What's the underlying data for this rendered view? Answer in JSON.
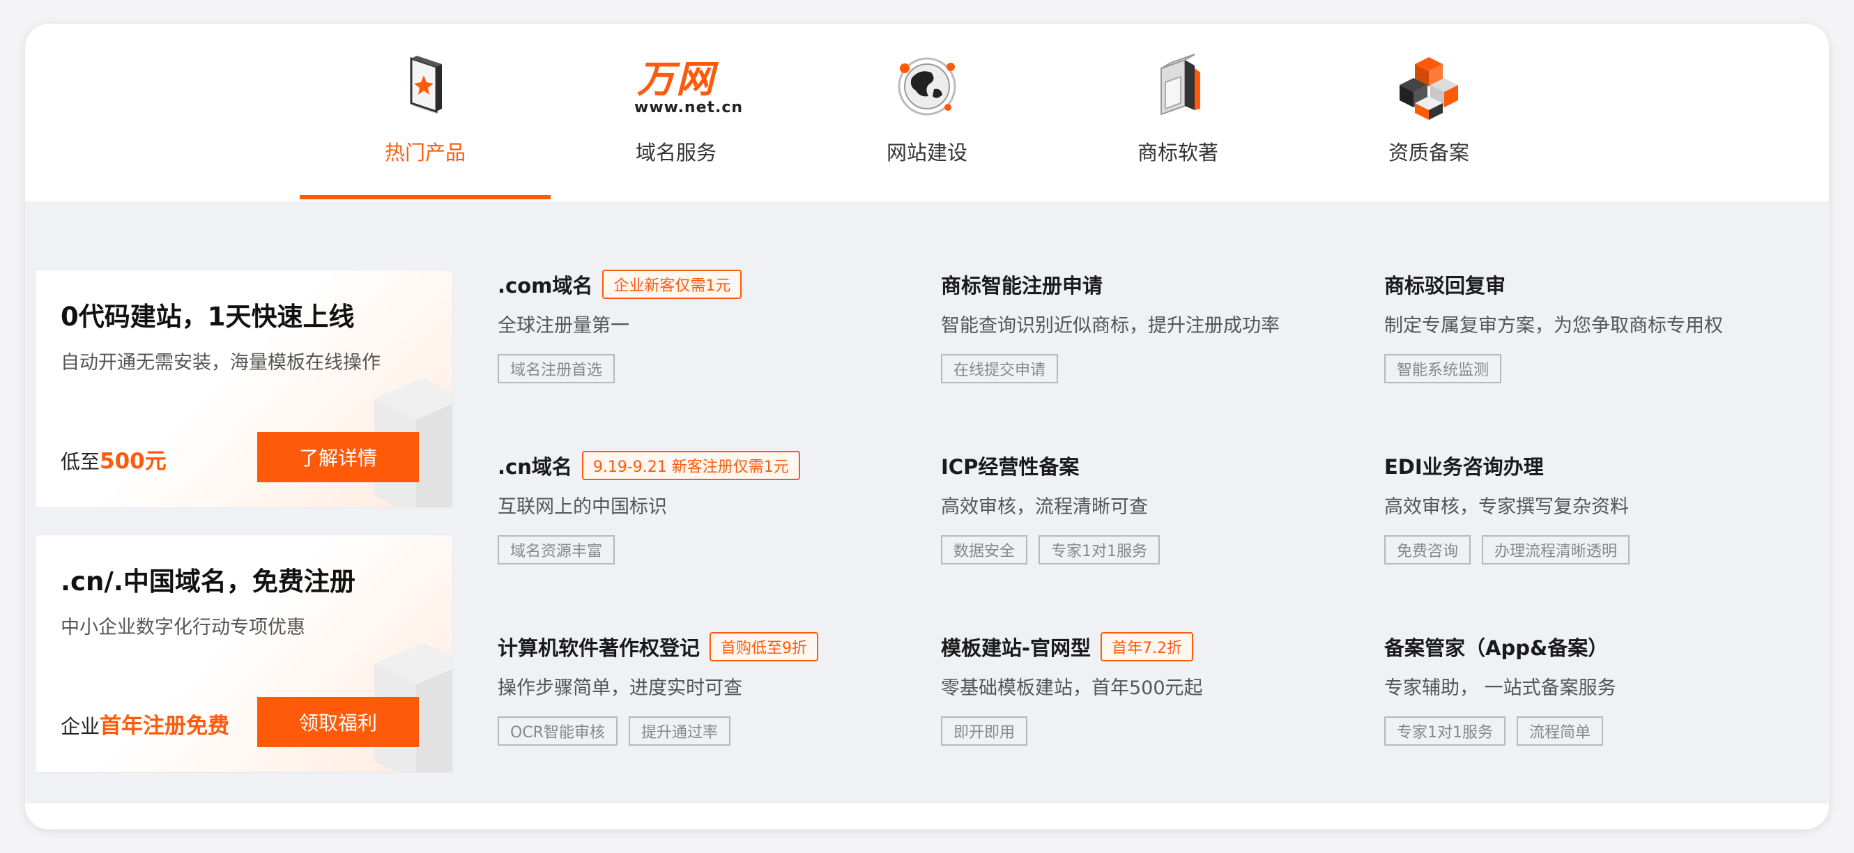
{
  "tabs": [
    {
      "label": "热门产品",
      "icon": "hot-product-icon",
      "active": true
    },
    {
      "label": "域名服务",
      "icon": "wanwang-logo",
      "logo_text": "万网",
      "logo_url": "www.net.cn",
      "active": false
    },
    {
      "label": "网站建设",
      "icon": "globe-icon",
      "active": false
    },
    {
      "label": "商标软著",
      "icon": "trademark-icon",
      "active": false
    },
    {
      "label": "资质备案",
      "icon": "cubes-icon",
      "active": false
    }
  ],
  "promos": [
    {
      "title": "0代码建站，1天快速上线",
      "desc": "自动开通无需安装，海量模板在线操作",
      "foot_prefix": "低至",
      "foot_highlight": "500元",
      "button": "了解详情"
    },
    {
      "title": ".cn/.中国域名，免费注册",
      "desc": "中小企业数字化行动专项优惠",
      "foot_prefix": "企业",
      "foot_highlight": "首年注册免费",
      "button": "领取福利"
    }
  ],
  "items": [
    {
      "title": ".com域名",
      "badge": "企业新客仅需1元",
      "desc": "全球注册量第一",
      "tags": [
        "域名注册首选"
      ]
    },
    {
      "title": "商标智能注册申请",
      "badge": "",
      "desc": "智能查询识别近似商标，提升注册成功率",
      "tags": [
        "在线提交申请"
      ]
    },
    {
      "title": "商标驳回复审",
      "badge": "",
      "desc": "制定专属复审方案，为您争取商标专用权",
      "tags": [
        "智能系统监测"
      ]
    },
    {
      "title": ".cn域名",
      "badge": "9.19-9.21 新客注册仅需1元",
      "desc": "互联网上的中国标识",
      "tags": [
        "域名资源丰富"
      ]
    },
    {
      "title": "ICP经营性备案",
      "badge": "",
      "desc": "高效审核，流程清晰可查",
      "tags": [
        "数据安全",
        "专家1对1服务"
      ]
    },
    {
      "title": "EDI业务咨询办理",
      "badge": "",
      "desc": "高效审核，专家撰写复杂资料",
      "tags": [
        "免费咨询",
        "办理流程清晰透明"
      ]
    },
    {
      "title": "计算机软件著作权登记",
      "badge": "首购低至9折",
      "desc": "操作步骤简单，进度实时可查",
      "tags": [
        "OCR智能审核",
        "提升通过率"
      ]
    },
    {
      "title": "模板建站-官网型",
      "badge": "首年7.2折",
      "desc": "零基础模板建站，首年500元起",
      "tags": [
        "即开即用"
      ]
    },
    {
      "title": "备案管家（App&备案）",
      "badge": "",
      "desc": "专家辅助， 一站式备案服务",
      "tags": [
        "专家1对1服务",
        "流程简单"
      ]
    }
  ],
  "colors": {
    "accent": "#ff5a0a",
    "panel_bg": "#f0f1f5"
  }
}
